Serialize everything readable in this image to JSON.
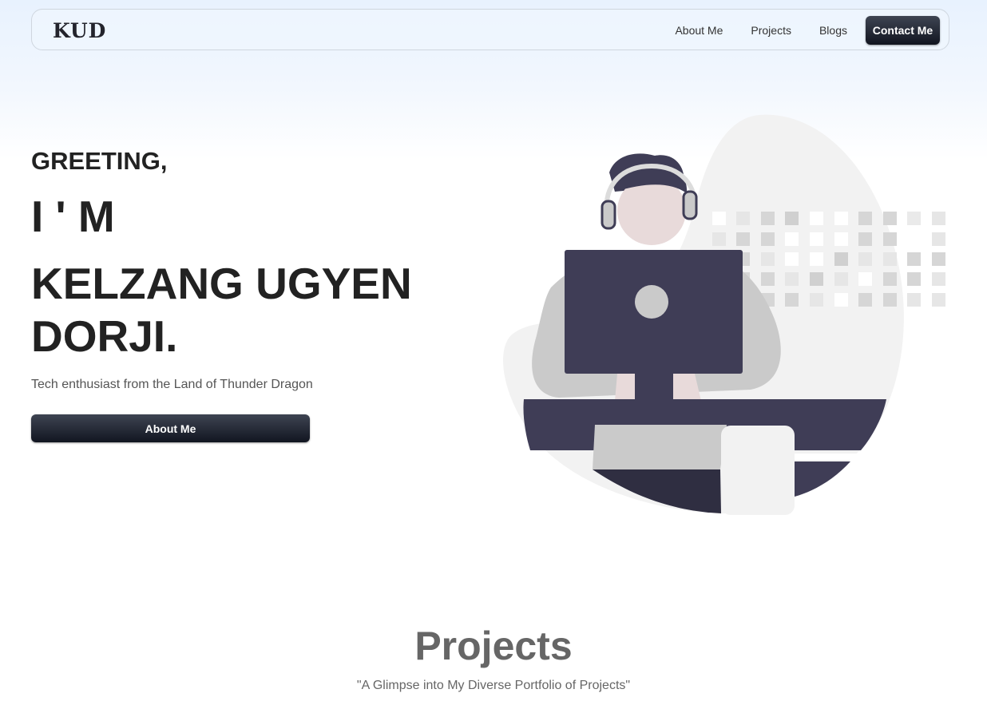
{
  "navbar": {
    "logo": "KUD",
    "links": [
      "About Me",
      "Projects",
      "Blogs"
    ],
    "contact_label": "Contact Me"
  },
  "hero": {
    "greeting": "GREETING,",
    "im": "I ' M",
    "name": "KELZANG UGYEN DORJI.",
    "tagline": "Tech enthusiast from the Land of Thunder Dragon",
    "button_label": "About Me"
  },
  "projects": {
    "title": "Projects",
    "subtitle": "\"A Glimpse into My Diverse Portfolio of Projects\""
  },
  "colors": {
    "accent_dark": "#111520",
    "illustration_dark": "#3f3d56",
    "illustration_light": "#f2f2f2",
    "illustration_gray": "#cacaca"
  }
}
